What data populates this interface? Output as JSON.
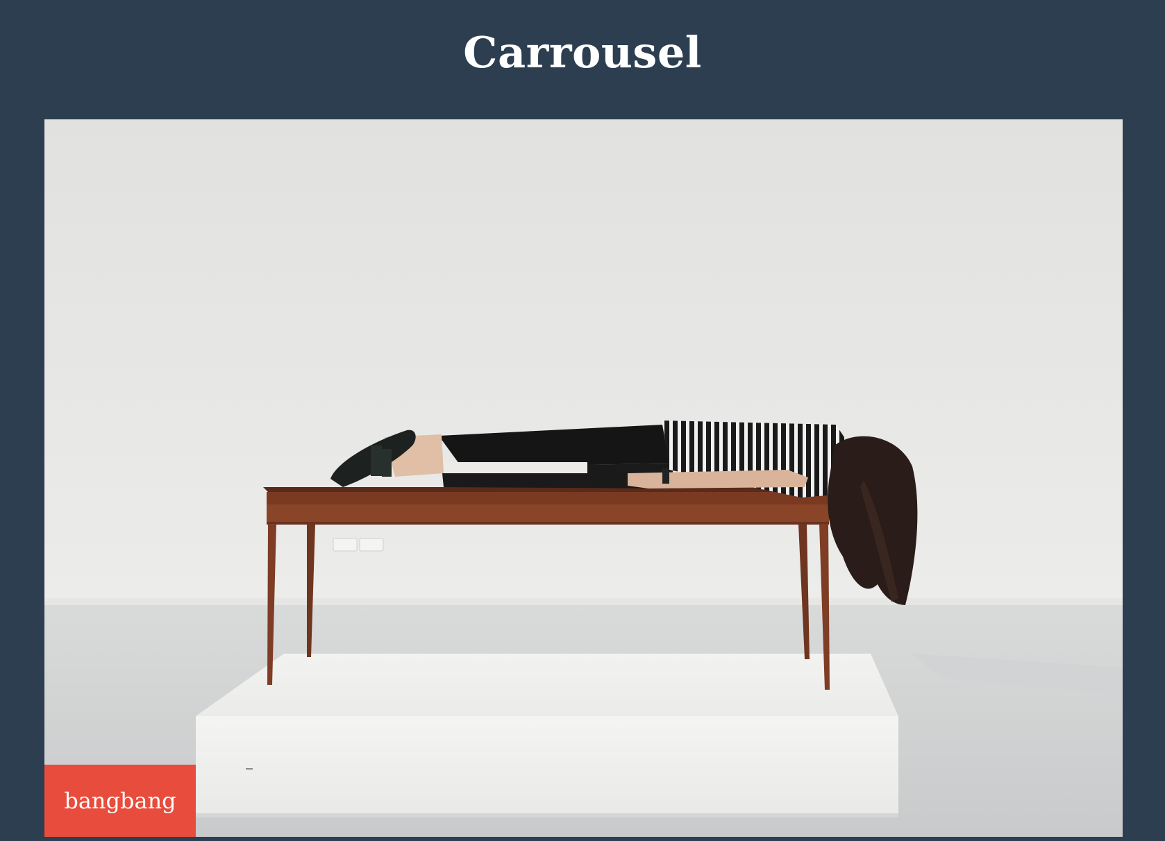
{
  "page": {
    "title": "Carrousel"
  },
  "carousel": {
    "slide": {
      "caption": "bangbang"
    }
  },
  "colors": {
    "background": "#2c3e50",
    "title_text": "#ffffff",
    "caption_background": "#e74c3c",
    "caption_text": "#ffffff"
  }
}
